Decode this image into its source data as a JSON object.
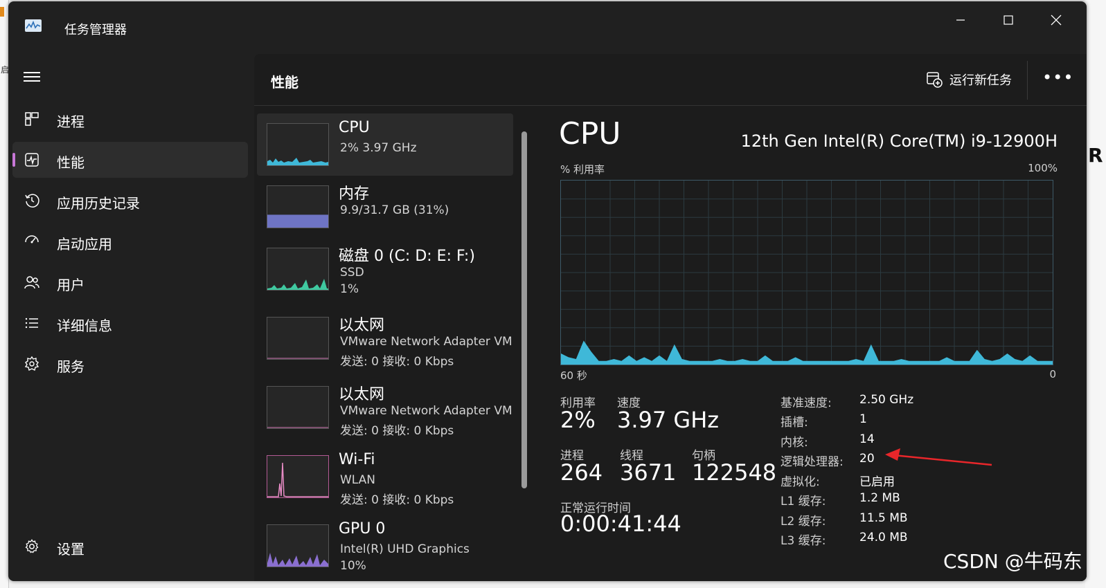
{
  "window": {
    "title": "任务管理器",
    "min_icon": "minimize-icon",
    "max_icon": "maximize-icon",
    "close_icon": "close-icon"
  },
  "nav": {
    "items": [
      {
        "label": "进程",
        "icon": "processes-icon",
        "active": false
      },
      {
        "label": "性能",
        "icon": "performance-icon",
        "active": true
      },
      {
        "label": "应用历史记录",
        "icon": "history-icon",
        "active": false
      },
      {
        "label": "启动应用",
        "icon": "startup-icon",
        "active": false
      },
      {
        "label": "用户",
        "icon": "users-icon",
        "active": false
      },
      {
        "label": "详细信息",
        "icon": "details-icon",
        "active": false
      },
      {
        "label": "服务",
        "icon": "services-icon",
        "active": false
      }
    ],
    "settings_label": "设置"
  },
  "header": {
    "title": "性能",
    "run_task_label": "运行新任务",
    "more": "•••"
  },
  "devices": [
    {
      "name": "CPU",
      "line1": "2%  3.97 GHz",
      "line2": "",
      "color": "#3fb8d8"
    },
    {
      "name": "内存",
      "line1": "9.9/31.7 GB (31%)",
      "line2": "",
      "color": "#7b82e0",
      "fill": 0.31
    },
    {
      "name": "磁盘 0 (C: D: E: F:)",
      "line1": "SSD",
      "line2": "1%",
      "color": "#3fc9a0"
    },
    {
      "name": "以太网",
      "line1": "VMware Network Adapter VM",
      "line2": "发送: 0  接收: 0 Kbps",
      "color": "#d37ab6"
    },
    {
      "name": "以太网",
      "line1": "VMware Network Adapter VM",
      "line2": "发送: 0  接收: 0 Kbps",
      "color": "#d37ab6"
    },
    {
      "name": "Wi-Fi",
      "line1": "WLAN",
      "line2": "发送: 0  接收: 0 Kbps",
      "color": "#e68bc4"
    },
    {
      "name": "GPU 0",
      "line1": "Intel(R) UHD Graphics",
      "line2": "10%",
      "color": "#8a6fd0"
    }
  ],
  "detail": {
    "title": "CPU",
    "model": "12th Gen Intel(R) Core(TM) i9-12900H",
    "chart_top_left": "% 利用率",
    "chart_top_right": "100%",
    "chart_bottom_left": "60 秒",
    "chart_bottom_right": "0",
    "stats": {
      "utilization_label": "利用率",
      "utilization": "2%",
      "speed_label": "速度",
      "speed": "3.97 GHz",
      "processes_label": "进程",
      "processes": "264",
      "threads_label": "线程",
      "threads": "3671",
      "handles_label": "句柄",
      "handles": "122548",
      "uptime_label": "正常运行时间",
      "uptime": "0:00:41:44"
    },
    "specs": [
      {
        "label": "基准速度:",
        "value": "2.50 GHz"
      },
      {
        "label": "插槽:",
        "value": "1"
      },
      {
        "label": "内核:",
        "value": "14"
      },
      {
        "label": "逻辑处理器:",
        "value": "20"
      },
      {
        "label": "虚拟化:",
        "value": "已启用"
      },
      {
        "label": "L1 缓存:",
        "value": "1.2 MB"
      },
      {
        "label": "L2 缓存:",
        "value": "11.5 MB"
      },
      {
        "label": "L3 缓存:",
        "value": "24.0 MB"
      }
    ]
  },
  "cpu_usage_history": [
    6,
    4,
    3,
    13,
    7,
    2,
    2,
    3,
    2,
    5,
    2,
    4,
    2,
    5,
    2,
    11,
    3,
    2,
    2,
    2,
    2,
    3,
    2,
    2,
    3,
    2,
    2,
    5,
    2,
    2,
    2,
    4,
    2,
    2,
    2,
    2,
    2,
    2,
    2,
    3,
    2,
    11,
    2,
    2,
    2,
    3,
    2,
    2,
    2,
    2,
    2,
    4,
    2,
    2,
    2,
    8,
    3,
    2,
    3,
    6,
    3,
    2,
    5,
    2,
    2,
    2
  ],
  "watermark": "CSDN @牛码东",
  "colors": {
    "accent": "#3fb8d8",
    "nav_indicator": "#c878d8",
    "annotation": "#e8262a"
  }
}
